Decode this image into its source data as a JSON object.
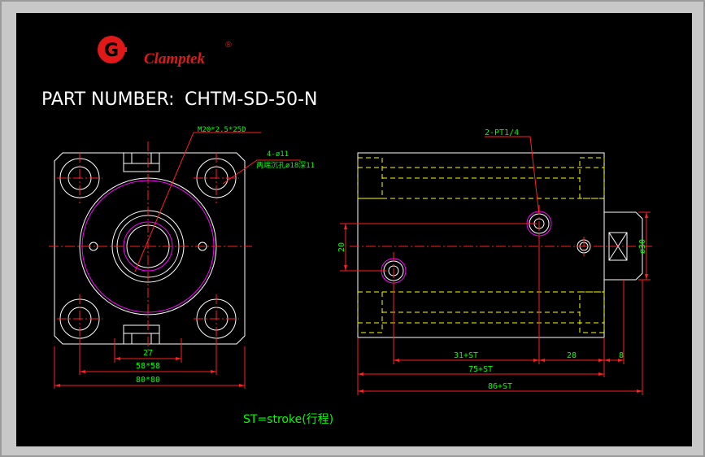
{
  "brand": {
    "logo_mark": "G",
    "name": "Clamptek",
    "registered": "®",
    "color": "#e01818"
  },
  "part_number": {
    "label": "PART NUMBER:",
    "value": "CHTM-SD-50-N"
  },
  "annotations": {
    "thread": "M20*2.5*25D",
    "holes_count": "4-ø11",
    "holes_counterbore": "两端沉孔ø18深11",
    "port": "2-PT1/4",
    "dim_27": "27",
    "dim_58": "58*58",
    "dim_80": "80*80",
    "dim_20": "20",
    "dim_d30": "ø30",
    "dim_31st": "31+ST",
    "dim_28": "28",
    "dim_8": "8",
    "dim_75st": "75+ST",
    "dim_86st": "86+ST",
    "stroke_note": "ST=stroke(行程)"
  },
  "colors": {
    "background": "#000000",
    "outline": "#ffffff",
    "dimension": "#ff2020",
    "dimension_text": "#00ff00",
    "hidden": "#ffff00",
    "magenta": "#ff00ff",
    "part_text": "#ffffff"
  }
}
